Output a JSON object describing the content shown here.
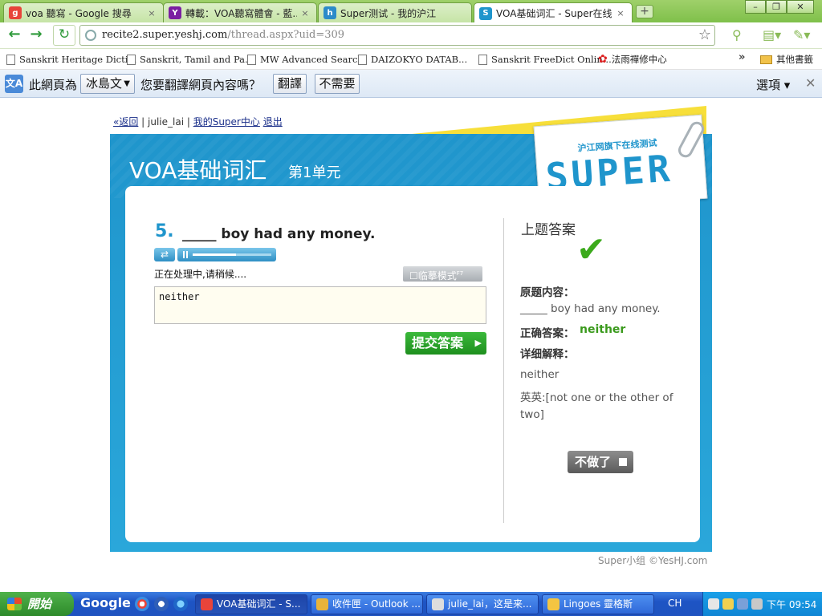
{
  "browser": {
    "tabs": [
      {
        "label": "voa 聽寫 - Google 搜尋",
        "favicon": "google-icon",
        "active": false
      },
      {
        "label": "轉載：VOA聽寫體會 - 藍...",
        "favicon": "yahoo-icon",
        "active": false
      },
      {
        "label": "Super测试 - 我的沪江",
        "favicon": "hujiang-icon",
        "active": false
      },
      {
        "label": "VOA基础词汇 - Super在线...",
        "favicon": "super-icon",
        "active": true
      }
    ],
    "url_host": "recite2.super.yeshj.com",
    "url_path": "/thread.aspx?uid=309",
    "bookmarks": [
      {
        "label": "Sanskrit Heritage Dicti..."
      },
      {
        "label": "Sanskrit, Tamil and Pa..."
      },
      {
        "label": "MW Advanced Search"
      },
      {
        "label": "DAIZOKYO DATAB..."
      },
      {
        "label": "Sanskrit FreeDict Onlin..."
      },
      {
        "label": "法雨禪修中心"
      }
    ],
    "bookmarks_more": "»",
    "other_bookmarks": "其他書籤"
  },
  "translate_bar": {
    "prompt_prefix": "此網頁為",
    "language": "冰島文",
    "prompt_suffix": "您要翻譯網頁內容嗎？",
    "translate_button": "翻譯",
    "no_button": "不需要",
    "options": "選項"
  },
  "page": {
    "nav_back": "«返回",
    "nav_sep1": " | ",
    "username": "julie_lai",
    "nav_sep2": " | ",
    "my_center": "我的Super中心",
    "logout": "退出",
    "title": "VOA基础词汇",
    "unit": "第1单元",
    "logo_tagline": "沪江网旗下在线测试",
    "logo_word": "SUPER",
    "question_number": "5.",
    "question_text": "_____ boy had any money.",
    "status_text": "正在处理中,请稍候....",
    "mode_button": "临摹模式",
    "mode_hint": "F7",
    "answer_value": "neither",
    "submit_button": "提交答案",
    "audio_progress": 0.55,
    "result": {
      "heading": "上题答案",
      "original_label": "原题内容：",
      "original_text": "_____ boy had any money.",
      "correct_label": "正确答案：",
      "correct_value": "neither",
      "explain_label": "详细解释：",
      "explain_word": "neither",
      "explain_line1": "英英:[not one or the other of",
      "explain_line2": "two]"
    },
    "quit_button": "不做了",
    "footer": "Super小组 ©YesHJ.com"
  },
  "taskbar": {
    "start": "開始",
    "google": "Google",
    "items": [
      {
        "label": "VOA基础词汇 - S..."
      },
      {
        "label": "收件匣 - Outlook ..."
      },
      {
        "label": "julie_lai，这是来..."
      },
      {
        "label": "Lingoes 靈格斯"
      }
    ],
    "lang": "CH",
    "clock": "下午 09:54"
  },
  "colors": {
    "accent_blue": "#1f95cc",
    "correct_green": "#3a9a1c",
    "chrome_green": "#8fc85a"
  }
}
